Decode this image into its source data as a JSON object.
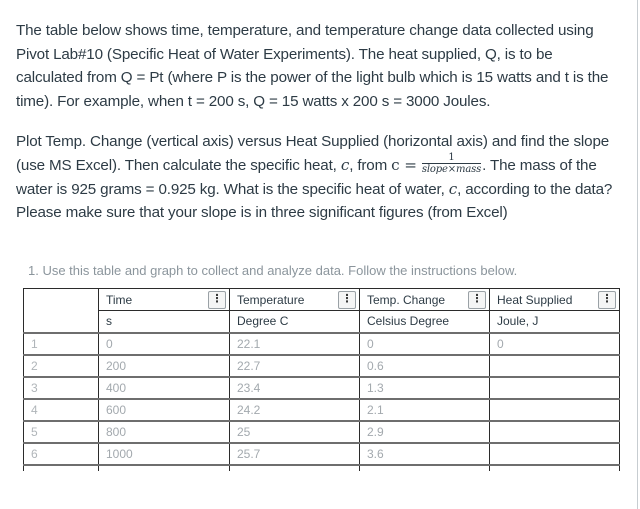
{
  "paragraph1": {
    "text": "The table below shows time, temperature, and temperature change data collected using Pivot Lab#10 (Specific Heat of Water Experiments). The heat supplied, Q, is to be calculated from Q = Pt (where P is the power of the light bulb which is 15 watts and  t  is the time). For example, when t = 200 s, Q = 15 watts x 200 s = 3000 Joules."
  },
  "paragraph2": {
    "before_formula": "Plot Temp. Change (vertical axis) versus Heat Supplied (horizontal axis) and find the slope (use MS Excel). Then calculate the specific heat, ",
    "c_symbol": "c",
    "from_text": ", from ",
    "formula_lhs": "c =",
    "formula_numerator": "1",
    "formula_denominator": "slope×mass",
    "after_formula": ". The mass of the water is 925 grams = 0.925 kg. What is the specific heat of water, ",
    "c_symbol2": "c",
    "end_text": ", according to the data? Please make sure that your slope is in three significant figures (from Excel)"
  },
  "instruction": "1.  Use this table and graph to collect and analyze data. Follow the instructions below.",
  "table": {
    "columns": [
      {
        "name": "Time",
        "unit": "s"
      },
      {
        "name": "Temperature",
        "unit": "Degree C"
      },
      {
        "name": "Temp. Change",
        "unit": "Celsius Degree"
      },
      {
        "name": "Heat Supplied",
        "unit": "Joule, J"
      }
    ],
    "rows": [
      {
        "index": "1",
        "time": "0",
        "temperature": "22.1",
        "temp_change": "0",
        "heat": "0"
      },
      {
        "index": "2",
        "time": "200",
        "temperature": "22.7",
        "temp_change": "0.6",
        "heat": ""
      },
      {
        "index": "3",
        "time": "400",
        "temperature": "23.4",
        "temp_change": "1.3",
        "heat": ""
      },
      {
        "index": "4",
        "time": "600",
        "temperature": "24.2",
        "temp_change": "2.1",
        "heat": ""
      },
      {
        "index": "5",
        "time": "800",
        "temperature": "25",
        "temp_change": "2.9",
        "heat": ""
      },
      {
        "index": "6",
        "time": "1000",
        "temperature": "25.7",
        "temp_change": "3.6",
        "heat": ""
      }
    ],
    "menu_icon": "kebab-menu-icon"
  }
}
